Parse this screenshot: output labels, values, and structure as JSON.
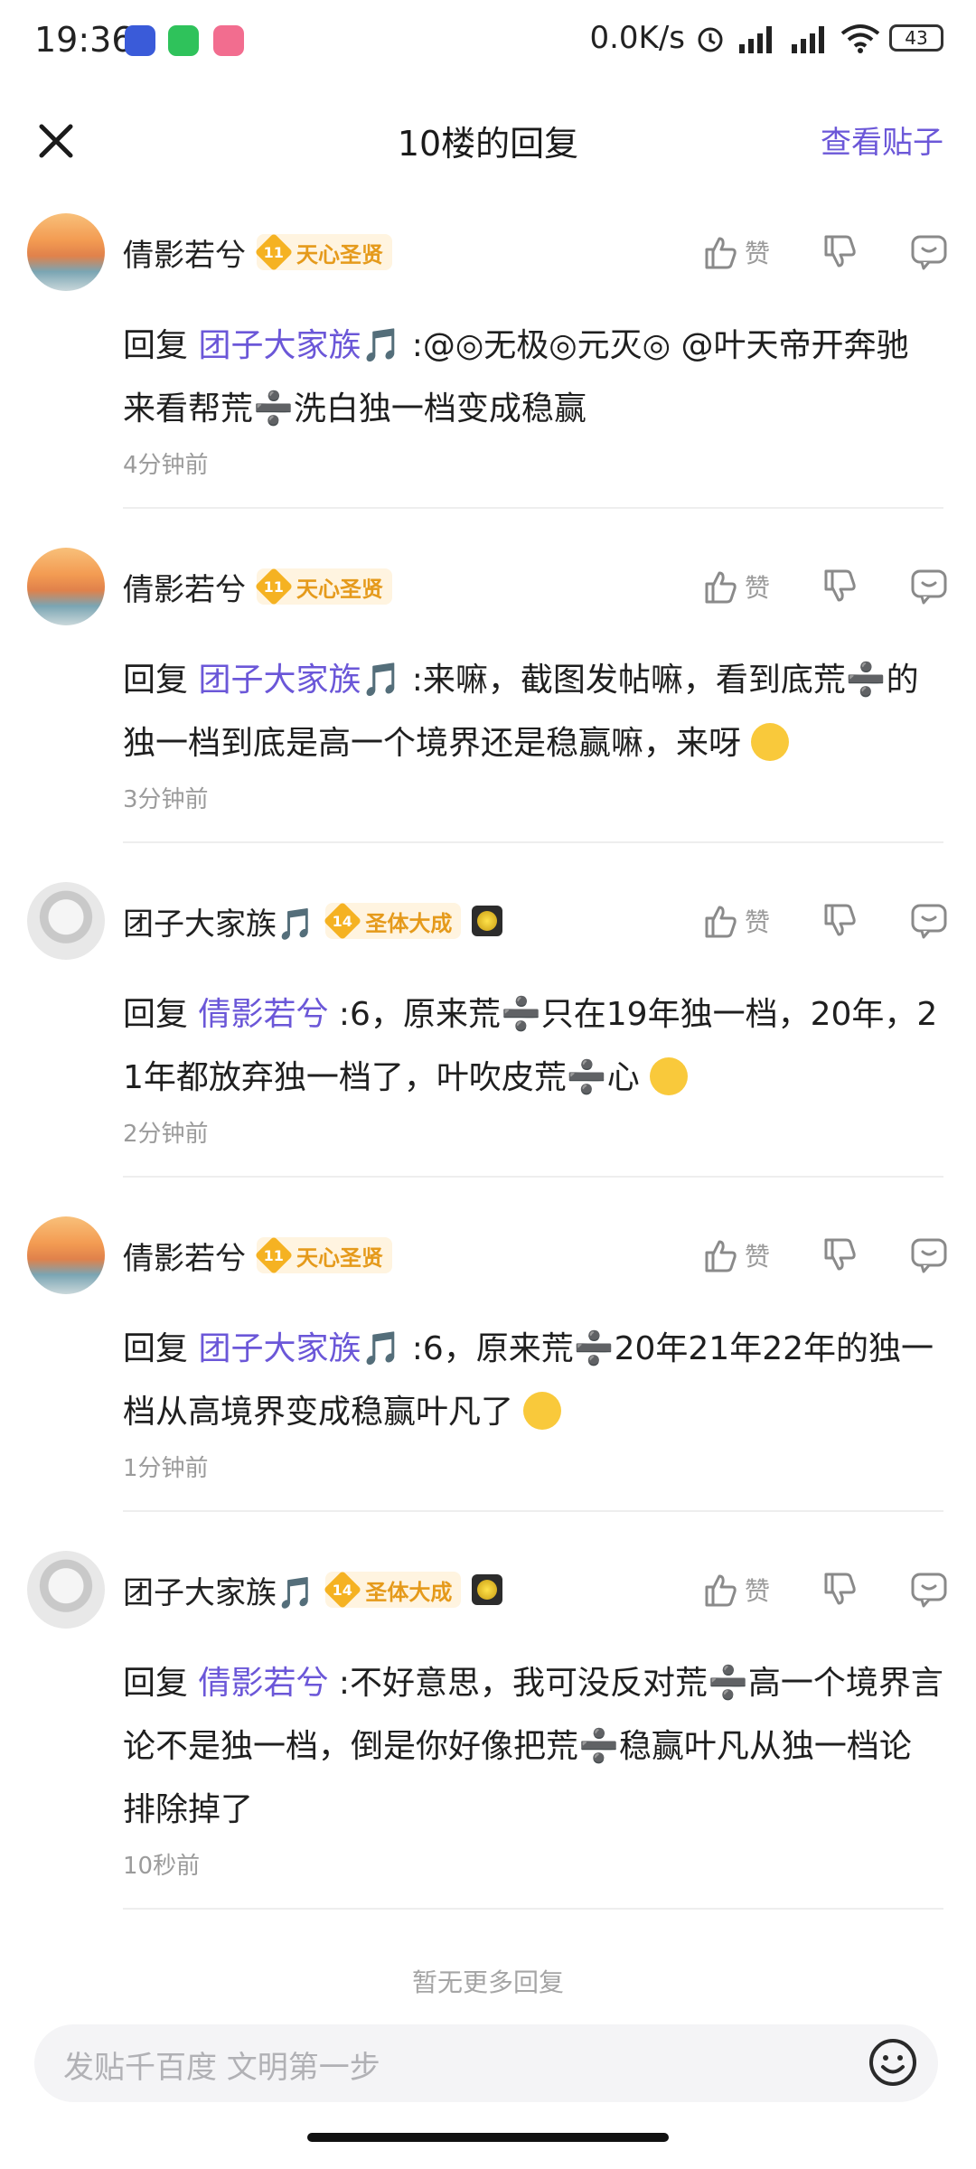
{
  "status_bar": {
    "time": "19:36",
    "net_speed": "0.0K/s",
    "battery": "43",
    "icons": [
      "tieba-app-icon",
      "wechat-icon",
      "bilibili-icon",
      "alarm-icon",
      "signal-hd-icon",
      "signal-hd-icon",
      "wifi-icon",
      "battery-icon"
    ]
  },
  "header": {
    "title": "10楼的回复",
    "view_post": "查看贴子"
  },
  "replies": [
    {
      "user": "倩影若兮",
      "level": "11",
      "rank": "天心圣贤",
      "like_label": "赞",
      "prefix": "回复 ",
      "target": "团子大家族🎵",
      "text": " :@◎无极◎元灭◎ @叶天帝开奔驰 来看帮荒➗洗白独一档变成稳赢",
      "time": "4分钟前"
    },
    {
      "user": "倩影若兮",
      "level": "11",
      "rank": "天心圣贤",
      "like_label": "赞",
      "prefix": "回复 ",
      "target": "团子大家族🎵",
      "text": " :来嘛，截图发帖嘛，看到底荒➗的独一档到底是高一个境界还是稳赢嘛，来呀",
      "time": "3分钟前"
    },
    {
      "user": "团子大家族🎵",
      "level": "14",
      "rank": "圣体大成",
      "like_label": "赞",
      "prefix": "回复 ",
      "target": "倩影若兮",
      "text": " :6，原来荒➗只在19年独一档，20年，21年都放弃独一档了，叶吹皮荒➗心",
      "time": "2分钟前"
    },
    {
      "user": "倩影若兮",
      "level": "11",
      "rank": "天心圣贤",
      "like_label": "赞",
      "prefix": "回复 ",
      "target": "团子大家族🎵",
      "text": " :6，原来荒➗20年21年22年的独一档从高境界变成稳赢叶凡了",
      "time": "1分钟前"
    },
    {
      "user": "团子大家族🎵",
      "level": "14",
      "rank": "圣体大成",
      "like_label": "赞",
      "prefix": "回复 ",
      "target": "倩影若兮",
      "text": " :不好意思，我可没反对荒➗高一个境界言论不是独一档，倒是你好像把荒➗稳赢叶凡从独一档论排除掉了",
      "time": "10秒前"
    }
  ],
  "footer": {
    "no_more": "暂无更多回复",
    "input_placeholder": "发贴千百度 文明第一步"
  },
  "colors": {
    "accent": "#6b57d8",
    "badge_gold": "#f5b222",
    "muted": "#9b9b9b"
  }
}
